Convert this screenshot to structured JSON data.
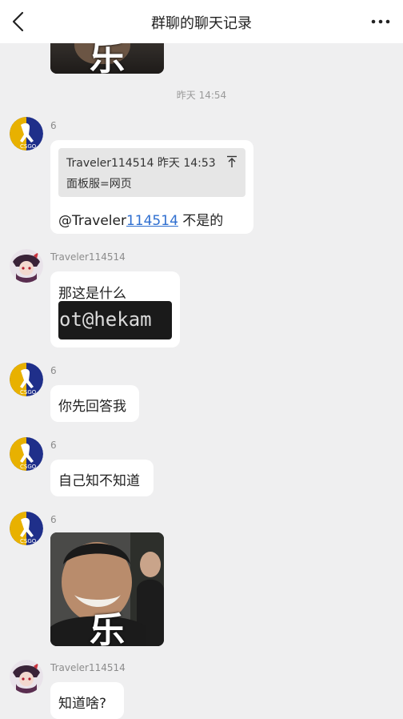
{
  "header": {
    "title": "群聊的聊天记录"
  },
  "time_divider": "昨天 14:54",
  "messages": [
    {
      "sender": "6",
      "quote": {
        "line1": "Traveler114514 昨天 14:53",
        "line2": "面板服=网页"
      },
      "text_prefix": "@Traveler",
      "text_link": "114514",
      "text_suffix": " 不是的"
    },
    {
      "sender": "Traveler114514",
      "text": "那这是什么",
      "image_text": "ot@hekam"
    },
    {
      "sender": "6",
      "text": "你先回答我"
    },
    {
      "sender": "6",
      "text": "自己知不知道"
    },
    {
      "sender": "6",
      "sticker_text": "乐"
    },
    {
      "sender": "Traveler114514",
      "text": "知道啥?"
    }
  ],
  "top_sticker_text": "乐",
  "colors": {
    "link": "#2f6fd0",
    "background": "#efeff0",
    "bubble": "#ffffff"
  },
  "icons": {
    "back": "chevron-left-icon",
    "more": "more-horizontal-icon",
    "quote_jump": "arrow-up-bar-icon"
  }
}
